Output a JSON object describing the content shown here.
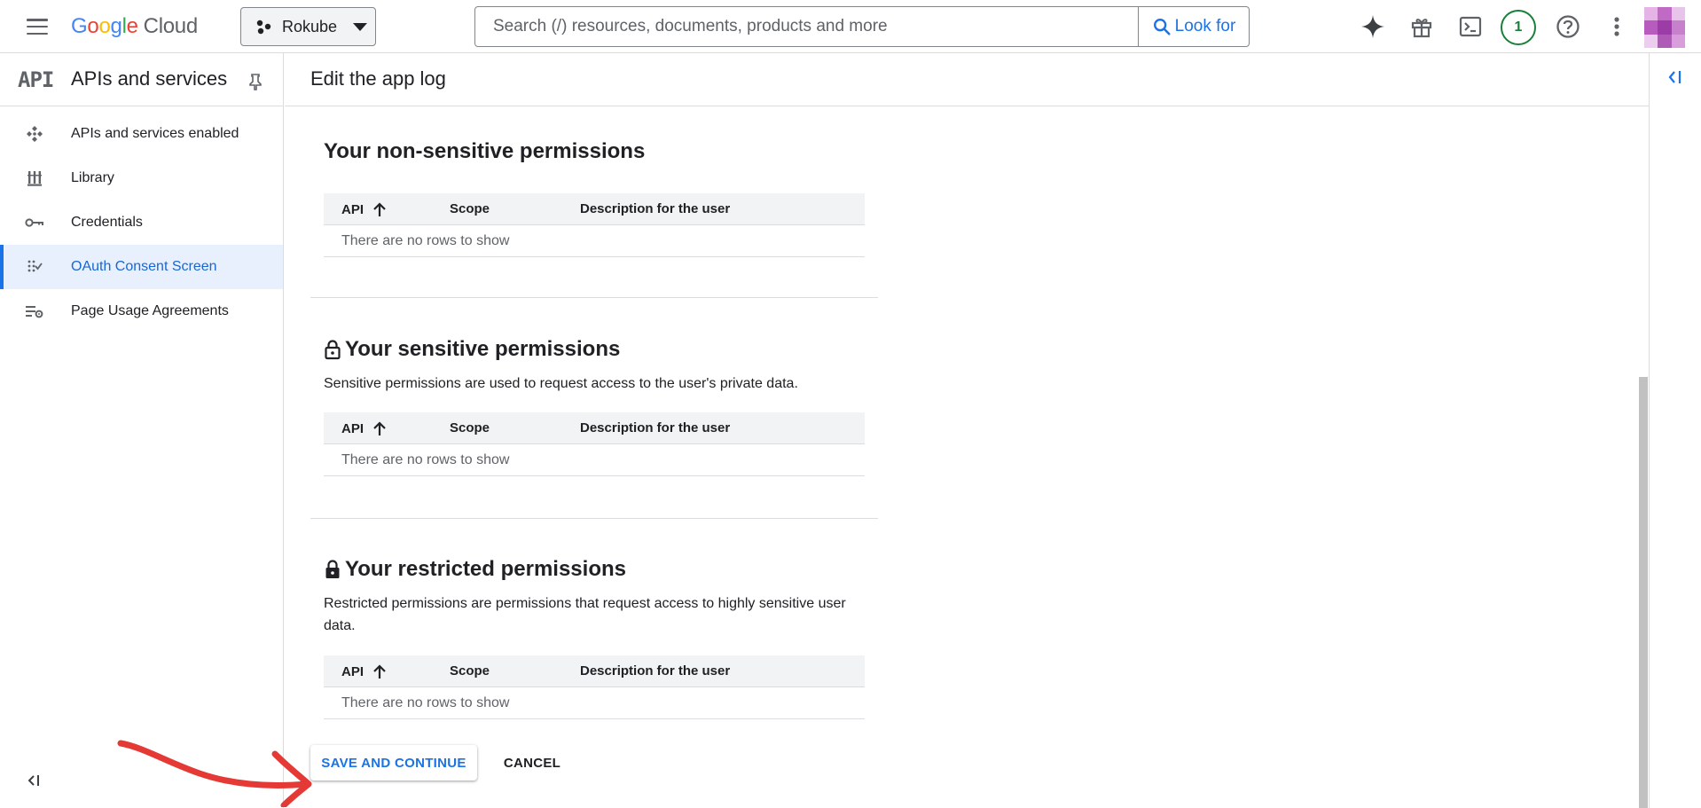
{
  "topbar": {
    "logo_google": "Google",
    "logo_cloud": "Cloud",
    "project_name": "Rokube",
    "search_placeholder": "Search (/) resources, documents, products and more",
    "search_button": "Look for",
    "notification_count": "1"
  },
  "sidebar": {
    "section_title": "APIs and services",
    "api_glyph": "API",
    "items": [
      {
        "label": "APIs and services enabled",
        "icon": "apis-diamond-icon"
      },
      {
        "label": "Library",
        "icon": "library-icon"
      },
      {
        "label": "Credentials",
        "icon": "key-icon"
      },
      {
        "label": "OAuth Consent Screen",
        "icon": "oauth-dots-icon",
        "active": true
      },
      {
        "label": "Page Usage Agreements",
        "icon": "settings-list-icon"
      }
    ]
  },
  "main": {
    "page_title": "Edit the app log",
    "sections": [
      {
        "title": "Your non-sensitive permissions",
        "description": "",
        "table": {
          "columns": [
            "API",
            "Scope",
            "Description for the user"
          ],
          "empty_text": "There are no rows to show"
        }
      },
      {
        "title": "Your sensitive permissions",
        "description": "Sensitive permissions are used to request access to the user's private data.",
        "table": {
          "columns": [
            "API",
            "Scope",
            "Description for the user"
          ],
          "empty_text": "There are no rows to show"
        }
      },
      {
        "title": "Your restricted permissions",
        "description": "Restricted permissions are permissions that request access to highly sensitive user data.",
        "table": {
          "columns": [
            "API",
            "Scope",
            "Description for the user"
          ],
          "empty_text": "There are no rows to show"
        }
      }
    ],
    "save_button": "SAVE AND CONTINUE",
    "cancel_button": "CANCEL"
  },
  "colors": {
    "accent": "#1a73e8",
    "annotation_arrow": "#e53935",
    "badge_green": "#188038"
  }
}
